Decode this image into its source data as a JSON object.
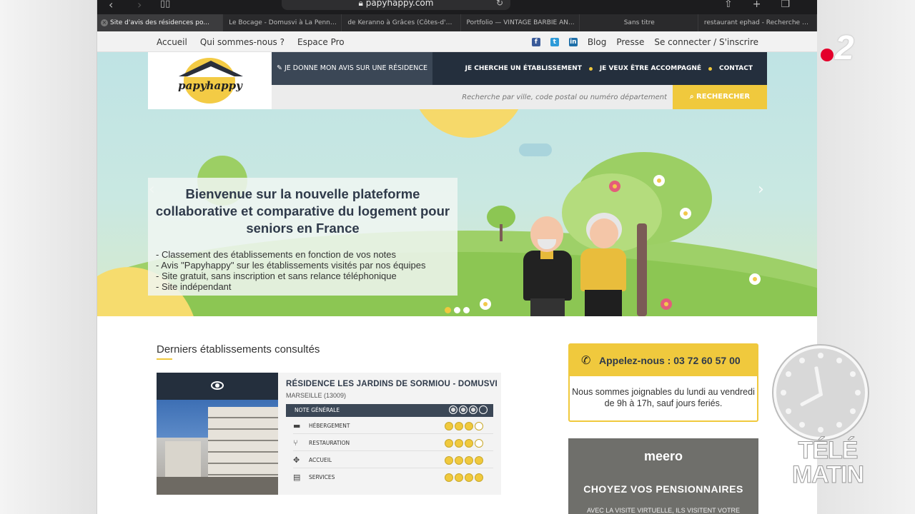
{
  "browser": {
    "url": "papyhappy.com",
    "tabs": [
      {
        "label": "Site d'avis des résidences po...",
        "active": true
      },
      {
        "label": "Le Bocage - Domusvi à La Penne...",
        "active": false
      },
      {
        "label": "de Keranno à Grâces (Côtes-d'A...",
        "active": false
      },
      {
        "label": "Portfolio — VINTAGE BARBIE AN...",
        "active": false
      },
      {
        "label": "Sans titre",
        "active": false
      },
      {
        "label": "restaurant ephad - Recherche G...",
        "active": false
      }
    ]
  },
  "site_nav": {
    "left": [
      "Accueil",
      "Qui sommes-nous ?",
      "Espace Pro"
    ],
    "social": [
      "f",
      "t",
      "in"
    ],
    "right": [
      "Blog",
      "Presse",
      "Se connecter / S'inscrire"
    ]
  },
  "header": {
    "logo_text": "papyhappy",
    "avis_button": "✎ JE DONNE MON AVIS SUR UNE RÉSIDENCE",
    "menu": [
      "JE CHERCHE UN ÉTABLISSEMENT",
      "JE VEUX ÊTRE ACCOMPAGNÉ",
      "CONTACT"
    ],
    "search_placeholder": "Recherche par ville, code postal ou numéro département",
    "search_button": "RECHERCHER"
  },
  "hero": {
    "title": "Bienvenue sur la nouvelle plateforme collaborative et comparative du logement pour seniors en France",
    "bullets": [
      "- Classement des établissements en fonction de vos notes",
      "- Avis \"Papyhappy\" sur les établissements visités par nos équipes",
      "- Site gratuit, sans inscription et sans relance téléphonique",
      "- Site indépendant"
    ],
    "slides": 3,
    "active_slide": 1
  },
  "recent": {
    "title": "Derniers établissements consultés",
    "card": {
      "name": "RÉSIDENCE LES JARDINS DE SORMIOU - DOMUSVI",
      "city": "MARSEILLE (13009)",
      "overall_label": "NOTE GÉNÉRALE",
      "overall_score": 3,
      "criteria": [
        {
          "label": "HÉBERGEMENT",
          "icon": "bed-icon",
          "score": 3
        },
        {
          "label": "RESTAURATION",
          "icon": "cutlery-icon",
          "score": 3
        },
        {
          "label": "ACCUEIL",
          "icon": "handshake-icon",
          "score": 4
        },
        {
          "label": "SERVICES",
          "icon": "clipboard-icon",
          "score": 4
        }
      ],
      "max_score": 4
    }
  },
  "call": {
    "title": "Appelez-nous : 03 72 60 57 00",
    "text": "Nous sommes joignables du lundi au vendredi de 9h à 17h, sauf jours feriés."
  },
  "ad": {
    "logo": "meero",
    "title": "CHOYEZ VOS PENSIONNAIRES",
    "subtitle": "AVEC LA VISITE VIRTUELLE, ILS VISITENT VOTRE"
  },
  "tv": {
    "channel": "2",
    "show_logo": [
      "TÉLÉ",
      "MATIN"
    ]
  },
  "colors": {
    "accent": "#f0c93d",
    "navy": "#242f3d",
    "channel_red": "#e4002b"
  }
}
